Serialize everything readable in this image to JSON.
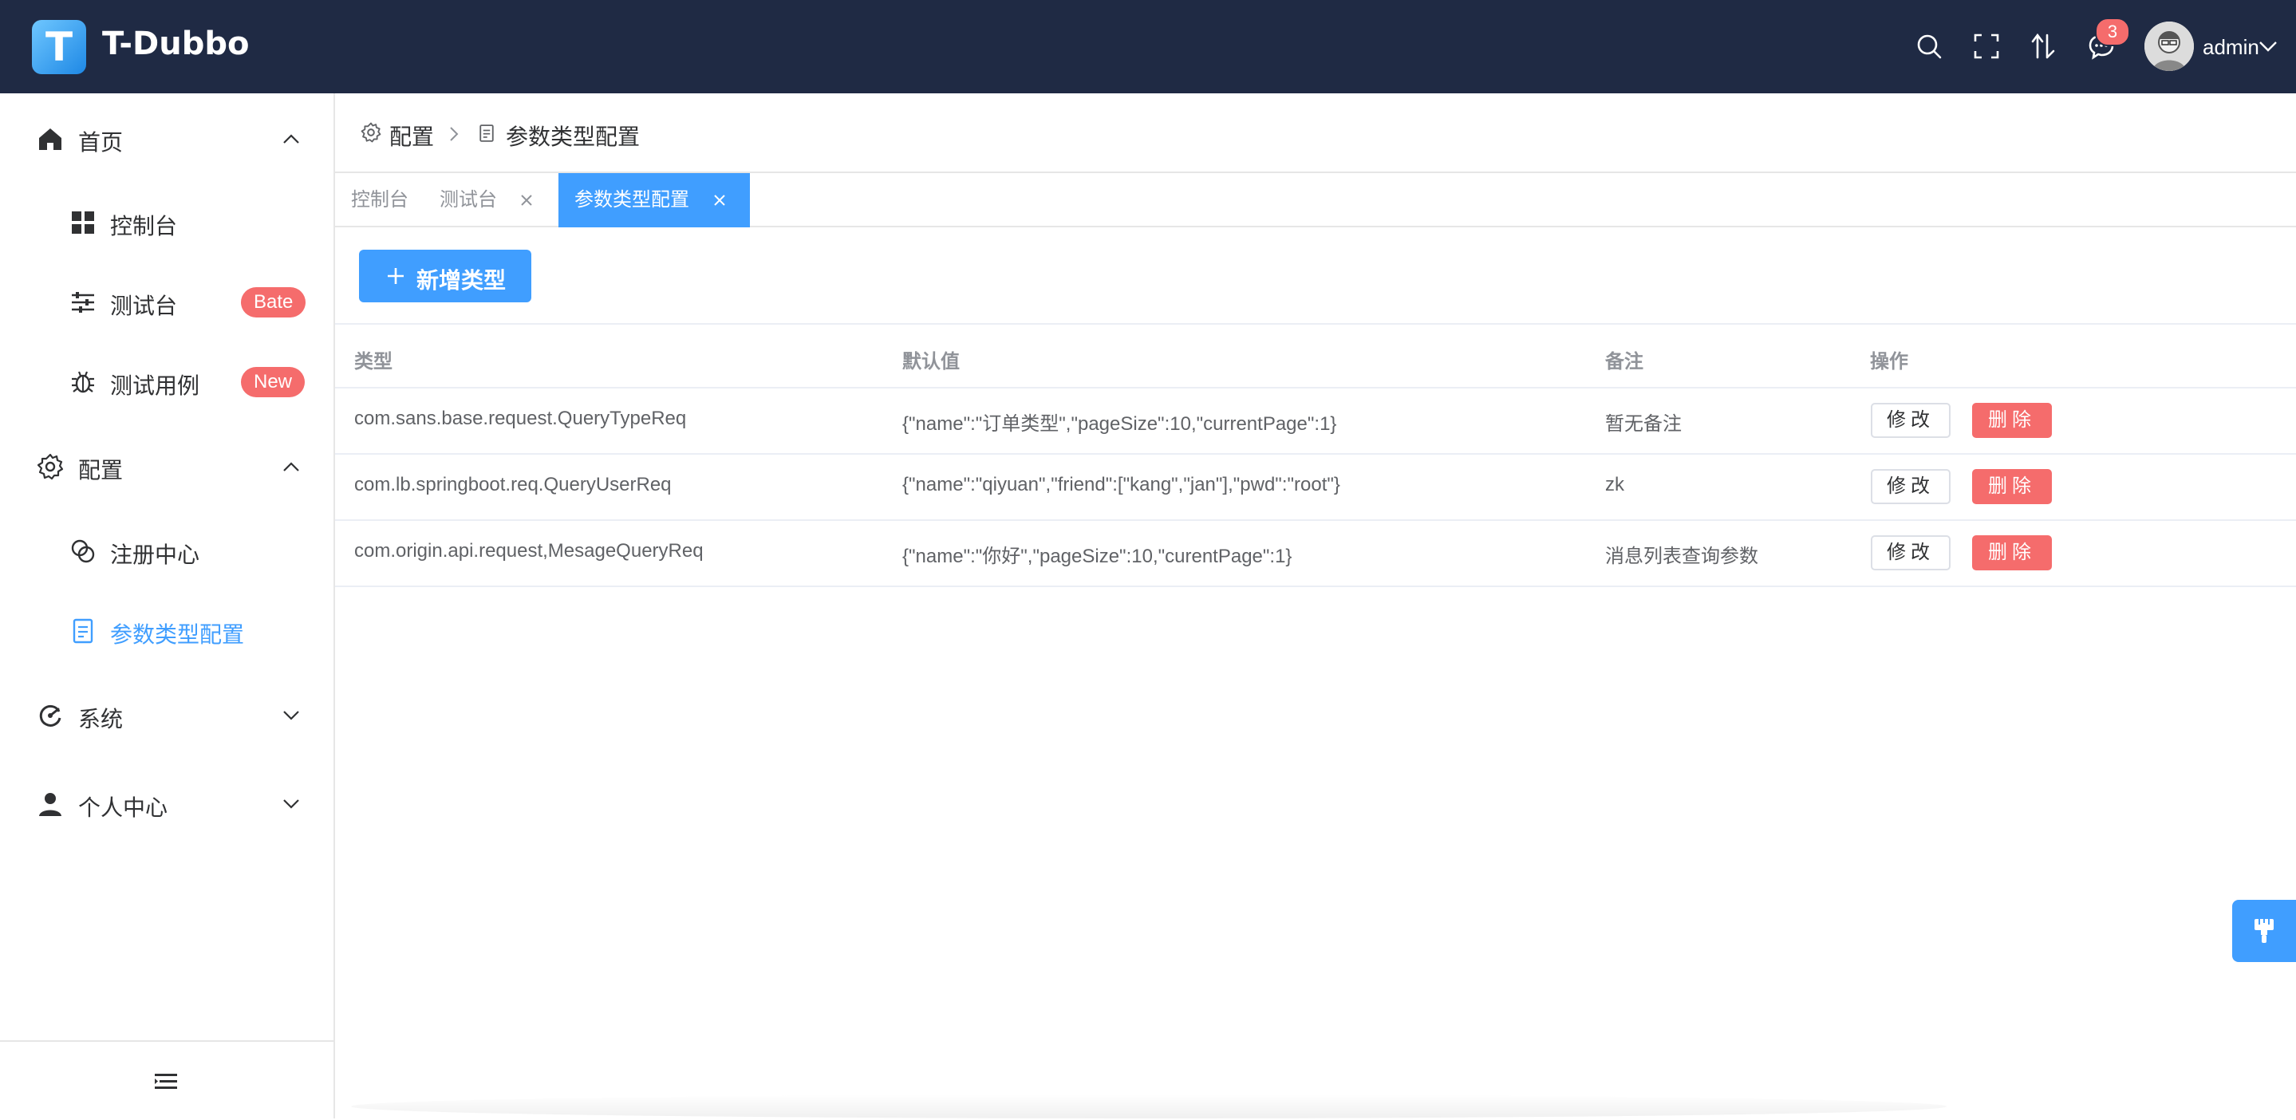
{
  "header": {
    "logo_letter": "T",
    "app_title": "T-Dubbo",
    "notification_count": "3",
    "username": "admin"
  },
  "sidebar": {
    "items": [
      {
        "label": "首页",
        "icon": "home-icon"
      },
      {
        "label": "控制台",
        "icon": "dashboard-icon"
      },
      {
        "label": "测试台",
        "icon": "sliders-icon",
        "tag": "Bate"
      },
      {
        "label": "测试用例",
        "icon": "bug-icon",
        "tag": "New"
      },
      {
        "label": "配置",
        "icon": "gear-icon"
      },
      {
        "label": "注册中心",
        "icon": "link-icon"
      },
      {
        "label": "参数类型配置",
        "icon": "document-icon"
      },
      {
        "label": "系统",
        "icon": "system-icon"
      },
      {
        "label": "个人中心",
        "icon": "user-icon"
      }
    ]
  },
  "breadcrumb": {
    "parent": "配置",
    "current": "参数类型配置"
  },
  "tabs": [
    {
      "label": "控制台"
    },
    {
      "label": "测试台"
    },
    {
      "label": "参数类型配置"
    }
  ],
  "toolbar": {
    "add_label": "新增类型"
  },
  "table": {
    "headers": [
      "类型",
      "默认值",
      "备注",
      "操作"
    ],
    "rows": [
      {
        "type": "com.sans.base.request.QueryTypeReq",
        "default": "{\"name\":\"订单类型\",\"pageSize\":10,\"currentPage\":1}",
        "remark": "暂无备注"
      },
      {
        "type": "com.lb.springboot.req.QueryUserReq",
        "default": "{\"name\":\"qiyuan\",\"friend\":[\"kang\",\"jan\"],\"pwd\":\"root\"}",
        "remark": "zk"
      },
      {
        "type": "com.origin.api.request,MesageQueryReq",
        "default": "{\"name\":\"你好\",\"pageSize\":10,\"curentPage\":1}",
        "remark": "消息列表查询参数"
      }
    ],
    "edit_label": "修改",
    "delete_label": "删除"
  },
  "colors": {
    "header_bg": "#1f2a44",
    "primary": "#409eff",
    "danger": "#f56c6c"
  }
}
